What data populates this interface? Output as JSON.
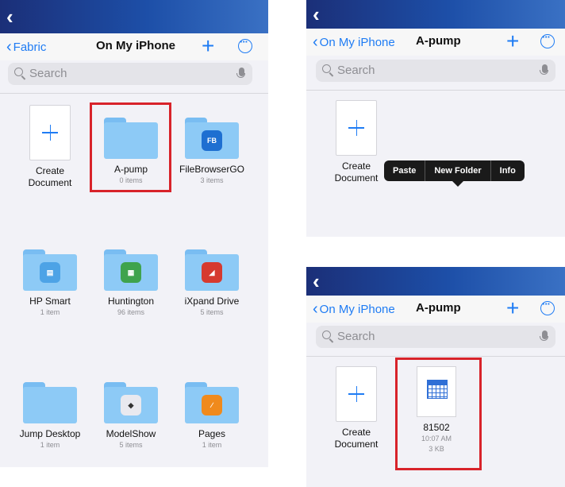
{
  "left": {
    "nav": {
      "back_label": "Fabric",
      "title": "On My iPhone"
    },
    "search": {
      "placeholder": "Search"
    },
    "items": [
      {
        "name": "Create\nDocument",
        "sub": ""
      },
      {
        "name": "A-pump",
        "sub": "0 items"
      },
      {
        "name": "FileBrowserGO",
        "sub": "3 items",
        "badge": "FB"
      },
      {
        "name": "HP Smart",
        "sub": "1 item"
      },
      {
        "name": "Huntington",
        "sub": "96 items"
      },
      {
        "name": "iXpand Drive",
        "sub": "5 items"
      },
      {
        "name": "Jump Desktop",
        "sub": "1 item"
      },
      {
        "name": "ModelShow",
        "sub": "5 items"
      },
      {
        "name": "Pages",
        "sub": "1 item"
      }
    ]
  },
  "right_top": {
    "nav": {
      "back_label": "On My iPhone",
      "title": "A-pump"
    },
    "search": {
      "placeholder": "Search"
    },
    "create": {
      "name": "Create\nDocument"
    },
    "context_menu": [
      "Paste",
      "New Folder",
      "Info"
    ]
  },
  "right_bottom": {
    "nav": {
      "back_label": "On My iPhone",
      "title": "A-pump"
    },
    "search": {
      "placeholder": "Search"
    },
    "create": {
      "name": "Create\nDocument"
    },
    "file": {
      "name": "81502",
      "time": "10:07 AM",
      "size": "3 KB"
    }
  },
  "colors": {
    "accent": "#1f7cf4",
    "highlight": "#d8232a",
    "topbar": "#1d4fa8",
    "folder": "#8dcaf6"
  }
}
